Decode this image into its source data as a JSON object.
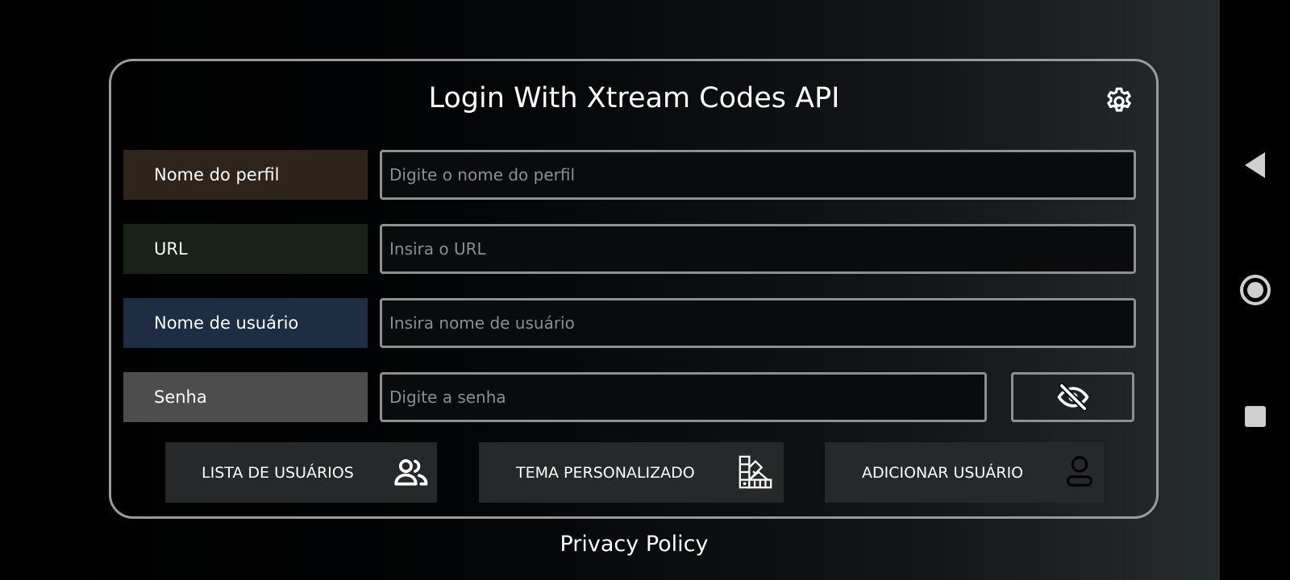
{
  "login": {
    "title": "Login With Xtream Codes API",
    "settings_icon": "gear-icon",
    "fields": [
      {
        "label": "Nome do perfil",
        "placeholder": "Digite o nome do perfil",
        "value": "",
        "color": "#2e2419"
      },
      {
        "label": "URL",
        "placeholder": "Insira o URL",
        "value": "",
        "color": "#172315"
      },
      {
        "label": "Nome de usuário",
        "placeholder": "Insira nome de usuário",
        "value": "",
        "color": "#1f2d42"
      },
      {
        "label": "Senha",
        "placeholder": "Digite a senha",
        "value": "",
        "color": "#4d4d4d"
      }
    ],
    "password_toggle_icon": "eye-off-icon",
    "actions": [
      {
        "label": "LISTA DE USUÁRIOS",
        "icon": "users-icon"
      },
      {
        "label": "TEMA PERSONALIZADO",
        "icon": "color-palette-icon"
      },
      {
        "label": "ADICIONAR USUÁRIO",
        "icon": "user-icon"
      }
    ]
  },
  "footer": {
    "privacy_link": "Privacy Policy"
  },
  "system_nav": {
    "back_icon": "back-triangle-icon",
    "home_icon": "home-circle-icon",
    "recents_icon": "recents-square-icon"
  },
  "colors": {
    "card_border": "#9a9a9a",
    "input_border": "#8f8f8f",
    "placeholder_text": "#8e8e8e",
    "button_background": "#262829"
  }
}
